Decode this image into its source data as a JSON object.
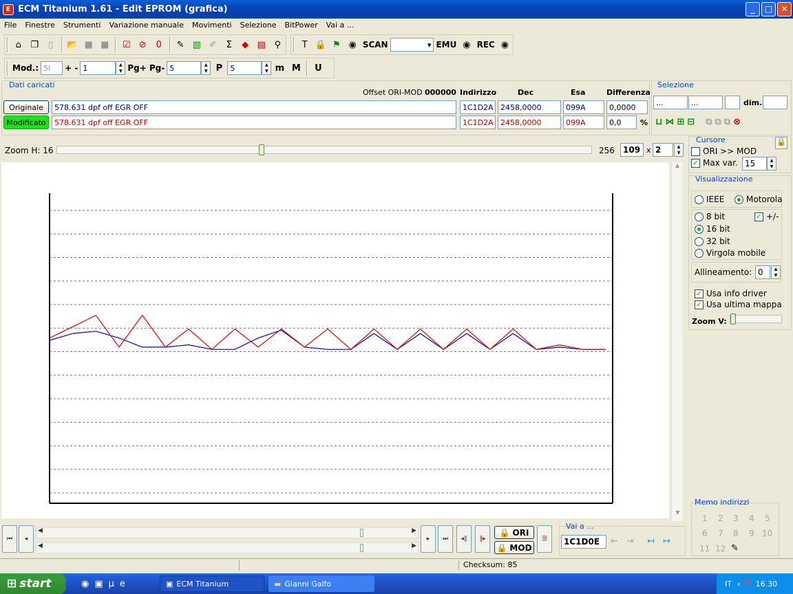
{
  "window": {
    "title": "ECM Titanium 1.61 - Edit EPROM (grafica)"
  },
  "menu": [
    "File",
    "Finestre",
    "Strumenti",
    "Variazione manuale",
    "Movimenti",
    "Selezione",
    "BitPower",
    "Vai a ..."
  ],
  "toolbar1": {
    "scan_label": "SCAN",
    "scan_value": "",
    "emu_label": "EMU",
    "rec_label": "REC"
  },
  "toolbar2": {
    "mod_label": "Mod.:",
    "mod_value": "5I",
    "plusminus_label": "+ -",
    "plusminus_value": "1",
    "pg_label": "Pg+ Pg-",
    "pg_value": "5",
    "p_value": "5"
  },
  "dati": {
    "title": "Dati caricati",
    "offset_label": "Offset ORI-MOD",
    "offset_value": "000000",
    "headers": {
      "indirizzo": "Indirizzo",
      "dec": "Dec",
      "esa": "Esa",
      "differenza": "Differenza"
    },
    "originale": {
      "button": "Originale",
      "name": "578.631 dpf off EGR OFF",
      "indirizzo": "1C1D2A",
      "dec": "2458,0000",
      "esa": "099A",
      "differenza": "0,0000"
    },
    "modificato": {
      "button": "Modificato",
      "name": "578.631 dpf off EGR OFF",
      "indirizzo": "1C1D2A",
      "dec": "2458,0000",
      "esa": "099A",
      "differenza": "0,0",
      "percent": "%"
    }
  },
  "selezione": {
    "title": "Selezione",
    "from": "...",
    "to": "...",
    "dim_label": "dim.",
    "dim_value": ""
  },
  "zoom": {
    "label": "Zoom H: 16",
    "max": "256",
    "value": "109",
    "times": "x",
    "mult": "2",
    "slider_fraction": 0.38
  },
  "cursore": {
    "title": "Cursore",
    "ori_mod_label": "ORI >> MOD",
    "ori_mod_checked": false,
    "maxvar_label": "Max var.",
    "maxvar_checked": true,
    "maxvar_value": "15"
  },
  "visualizzazione": {
    "title": "Visualizzazione",
    "ieee": "IEEE",
    "motorola": "Motorola",
    "bit8": "8 bit",
    "plusminus": "+/-",
    "bit16": "16 bit",
    "bit32": "32 bit",
    "virgola": "Virgola mobile",
    "allineamento_label": "Allineamento:",
    "allineamento_value": "0",
    "usa_info": "Usa info driver",
    "usa_ultima": "Usa ultima mappa",
    "zoomv_label": "Zoom V:"
  },
  "memo": {
    "title": "Memo indirizzi",
    "numbers": [
      "1",
      "2",
      "3",
      "4",
      "5",
      "6",
      "7",
      "8",
      "9",
      "10",
      "11",
      "12"
    ]
  },
  "vai": {
    "title": "Vai a ...",
    "value": "1C1D0E"
  },
  "bottom": {
    "ori_label": "ORI",
    "mod_label": "MOD"
  },
  "status": {
    "checksum": "Checksum: 85"
  },
  "taskbar": {
    "start": "start",
    "task1": "ECM Titanium",
    "task2": "Gianni Galfo",
    "lang": "IT",
    "clock": "16.30"
  },
  "colors": {
    "ori": "#0000c0",
    "mod": "#e00000",
    "highlight_mod": "#00e000",
    "accent": "#0046d5"
  },
  "chart_data": {
    "type": "line",
    "gridlines": 13,
    "series": [
      {
        "color": "#0000c0",
        "values": [
          0.5,
          0.8,
          0.9,
          0.6,
          0.2,
          0.2,
          0.3,
          0.1,
          0.1,
          0.6,
          0.95,
          0.2,
          0.1,
          0.1,
          0.8,
          0.1,
          0.8,
          0.1,
          0.8,
          0.1,
          0.8,
          0.1,
          0.2,
          0.1,
          0.1
        ]
      },
      {
        "color": "#e00000",
        "values": [
          0.6,
          1.1,
          1.6,
          0.2,
          1.6,
          0.2,
          1.0,
          0.1,
          1.0,
          0.2,
          1.0,
          0.2,
          1.0,
          0.1,
          1.0,
          0.1,
          1.0,
          0.1,
          1.0,
          0.1,
          1.0,
          0.1,
          0.3,
          0.1,
          0.1
        ]
      }
    ]
  }
}
